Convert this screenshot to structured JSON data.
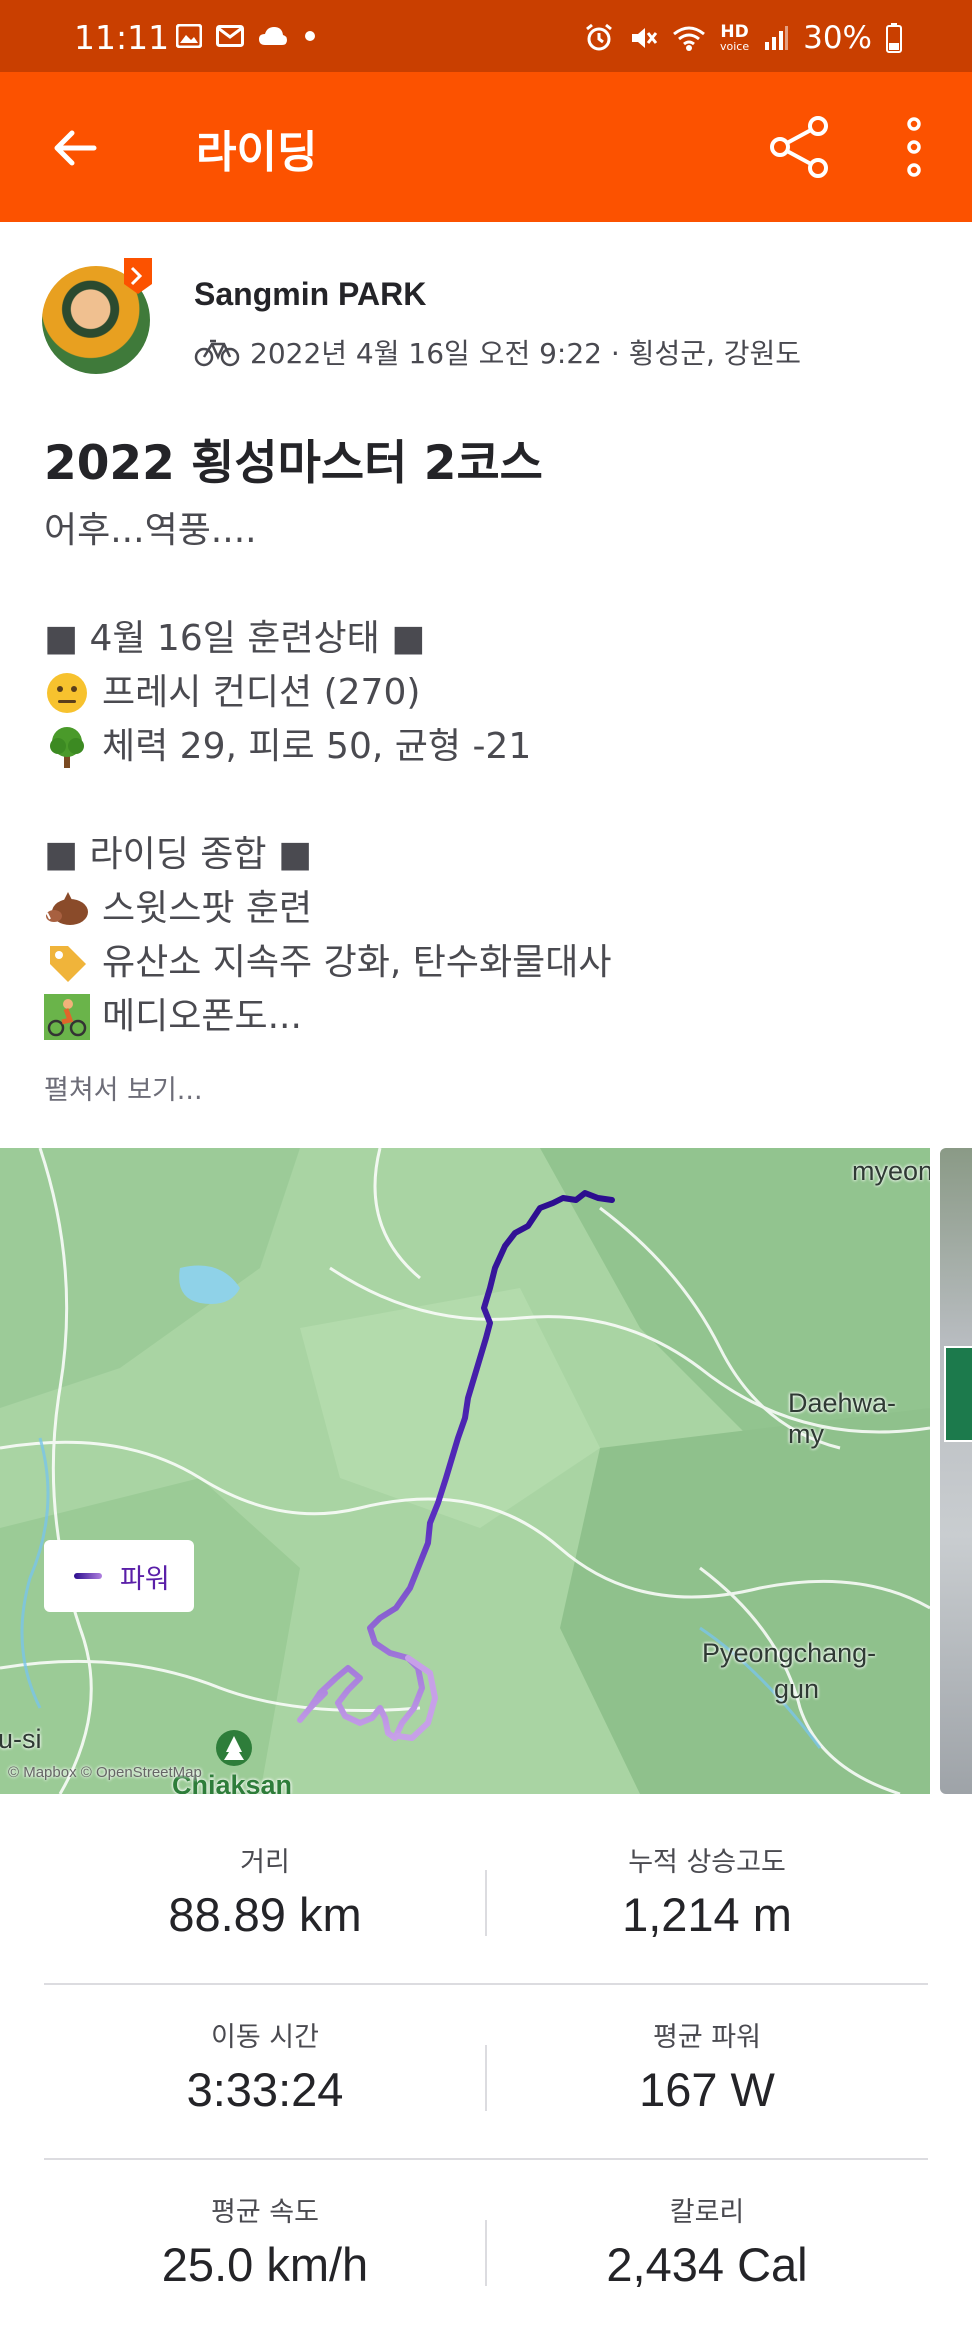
{
  "status_bar": {
    "time": "11:11",
    "battery": "30%",
    "hd_label": "HD",
    "hd_sub": "voice",
    "icons": [
      "gallery-icon",
      "mail-icon",
      "cloud-icon",
      "dot-icon",
      "alarm-icon",
      "mute-icon",
      "wifi-icon",
      "hd-voice-icon",
      "signal-icon",
      "battery-icon"
    ]
  },
  "app_bar": {
    "title": "라이딩",
    "back_icon": "arrow-left-icon",
    "share_icon": "share-icon",
    "more_icon": "more-vertical-icon"
  },
  "athlete": {
    "name": "Sangmin PARK",
    "activity_icon": "bicycle-icon",
    "meta": "2022년 4월 16일 오전 9:22 · 횡성군, 강원도"
  },
  "activity": {
    "title": "2022 횡성마스터 2코스",
    "description": {
      "line1": "어후...역풍....",
      "line2": "■ 4월 16일 훈련상태 ■",
      "line3": "프레시 컨디션 (270)",
      "line4": "체력 29, 피로 50, 균형 -21",
      "line5": "■ 라이딩 종합 ■",
      "line6": "스윗스팟 훈련",
      "line7": "유산소 지속주 강화, 탄수화물대사",
      "line8": "메디오폰도..."
    },
    "expand_label": "펼쳐서 보기..."
  },
  "map": {
    "labels": {
      "myeon": "myeon",
      "daehwa": "Daehwa-my",
      "pyeongchang1": "Pyeongchang-",
      "pyeongchang2": "gun",
      "si": "u-si",
      "chiaksan": "Chiaksan",
      "attribution": "© Mapbox © OpenStreetMap"
    },
    "legend_label": "파워",
    "colors": {
      "route_dark": "#2b0d8e",
      "route_light": "#c7a0e8"
    }
  },
  "stats": [
    {
      "left_label": "거리",
      "left_value": "88.89 km",
      "right_label": "누적 상승고도",
      "right_value": "1,214 m"
    },
    {
      "left_label": "이동 시간",
      "left_value": "3:33:24",
      "right_label": "평균 파워",
      "right_value": "167 W"
    },
    {
      "left_label": "평균 속도",
      "left_value": "25.0 km/h",
      "right_label": "칼로리",
      "right_value": "2,434 Cal"
    }
  ],
  "colors": {
    "brand": "#fc5200",
    "status_bar": "#c93f00"
  }
}
